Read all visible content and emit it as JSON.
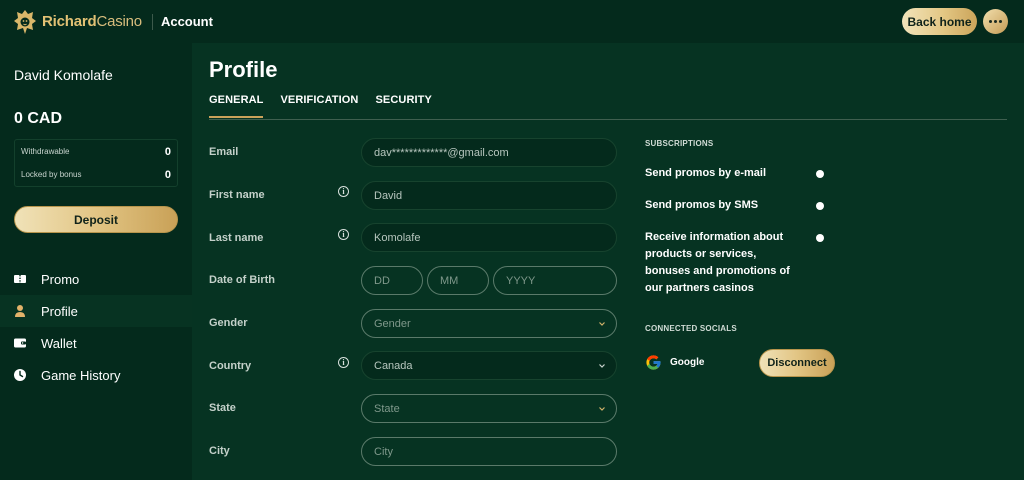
{
  "header": {
    "brand_bold": "Richard",
    "brand_light": "Casino",
    "section": "Account",
    "back_home_label": "Back home",
    "menu_icon": "more-icon"
  },
  "sidebar": {
    "user_name": "David Komolafe",
    "balance": "0 CAD",
    "withdrawable_label": "Withdrawable",
    "withdrawable_value": "0",
    "locked_label": "Locked by bonus",
    "locked_value": "0",
    "deposit_label": "Deposit",
    "nav": [
      {
        "label": "Promo",
        "icon": "promo-icon"
      },
      {
        "label": "Profile",
        "icon": "user-icon",
        "active": true
      },
      {
        "label": "Wallet",
        "icon": "wallet-icon"
      },
      {
        "label": "Game History",
        "icon": "clock-icon"
      }
    ]
  },
  "page": {
    "title": "Profile",
    "tabs": [
      {
        "label": "GENERAL",
        "active": true
      },
      {
        "label": "VERIFICATION"
      },
      {
        "label": "SECURITY"
      }
    ]
  },
  "form": {
    "email_label": "Email",
    "email_value": "dav*************@gmail.com",
    "first_name_label": "First name",
    "first_name_value": "David",
    "last_name_label": "Last name",
    "last_name_value": "Komolafe",
    "dob_label": "Date of Birth",
    "dob_day_placeholder": "DD",
    "dob_month_placeholder": "MM",
    "dob_year_placeholder": "YYYY",
    "gender_label": "Gender",
    "gender_placeholder": "Gender",
    "country_label": "Country",
    "country_value": "Canada",
    "state_label": "State",
    "state_placeholder": "State",
    "city_label": "City",
    "city_placeholder": "City"
  },
  "subscriptions": {
    "title": "SUBSCRIPTIONS",
    "email_promos": "Send promos by e-mail",
    "sms_promos": "Send promos by SMS",
    "partner_info": "Receive information about products or services, bonuses and promotions of our partners casinos"
  },
  "socials": {
    "title": "CONNECTED SOCIALS",
    "provider": "Google",
    "disconnect_label": "Disconnect"
  },
  "colors": {
    "background": "#063322",
    "panel": "#042a1c",
    "accent_gold": "#e2c584"
  }
}
